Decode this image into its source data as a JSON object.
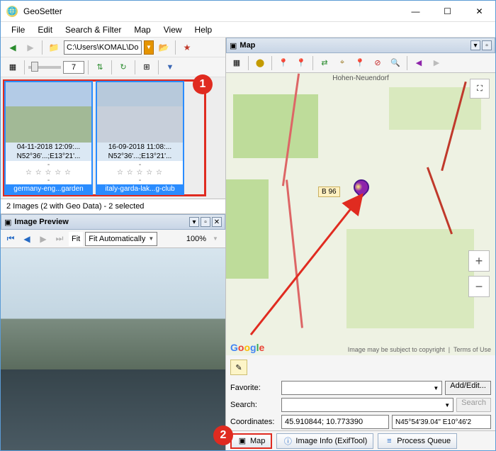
{
  "window": {
    "title": "GeoSetter"
  },
  "menu": {
    "file": "File",
    "edit": "Edit",
    "search": "Search & Filter",
    "map": "Map",
    "view": "View",
    "help": "Help"
  },
  "path": {
    "value": "C:\\Users\\KOMAL\\Docum"
  },
  "spin7": "7",
  "thumbs": {
    "items": [
      {
        "date": "04-11-2018 12:09:...",
        "coord": "N52°36'...;E13°21'...",
        "name": "germany-eng...garden"
      },
      {
        "date": "16-09-2018 11:08:...",
        "coord": "N52°36'...;E13°21'...",
        "name": "italy-garda-lak...g-club"
      }
    ],
    "marker": "1"
  },
  "status": "2 Images (2 with Geo Data) - 2 selected",
  "preview": {
    "title": "Image Preview",
    "fit_label": "Fit",
    "fit_combo": "Fit Automatically",
    "zoom": "100%"
  },
  "mapPanel": {
    "title": "Map",
    "road_label": "B 96",
    "town": "Hohen-Neuendorf",
    "copyright": "Image may be subject to copyright",
    "terms": "Terms of Use"
  },
  "form": {
    "favorite_label": "Favorite:",
    "addedit": "Add/Edit...",
    "search_label": "Search:",
    "search_btn": "Search",
    "coord_label": "Coordinates:",
    "coord_val": "45.910844; 10.773390",
    "coord_dms": "N45°54'39.04\" E10°46'2"
  },
  "tabs": {
    "map": "Map",
    "info": "Image Info (ExifTool)",
    "queue": "Process Queue",
    "marker": "2"
  }
}
